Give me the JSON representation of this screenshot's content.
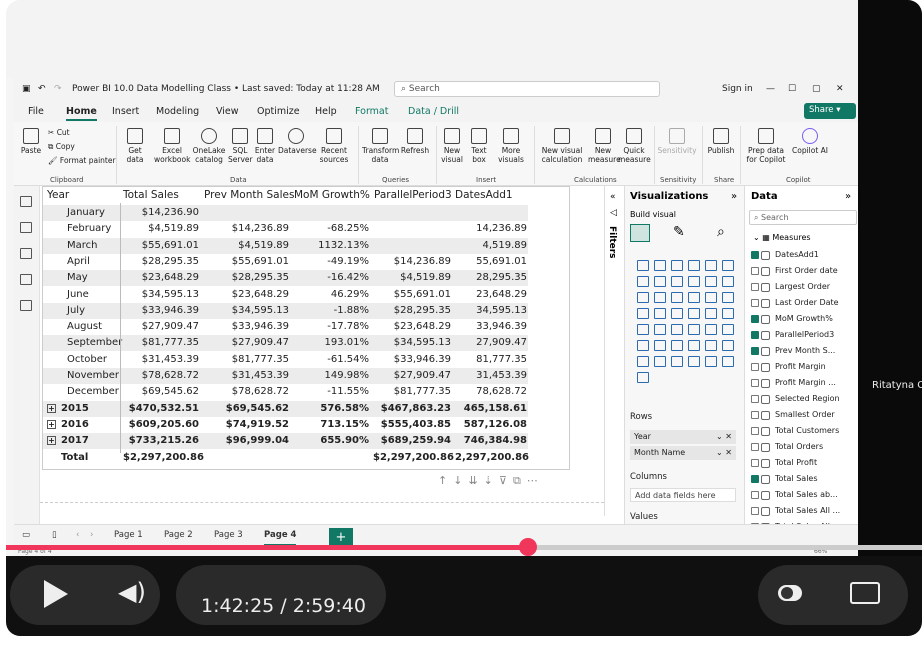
{
  "window": {
    "title": "Power BI 10.0 Data Modelling Class • Last saved: Today at 11:28 AM",
    "search_placeholder": "Search",
    "signin": "Sign in"
  },
  "menu": [
    "File",
    "Home",
    "Insert",
    "Modeling",
    "View",
    "Optimize",
    "Help",
    "Format",
    "Data / Drill"
  ],
  "share_label": "Share",
  "ribbon": {
    "clipboard": {
      "paste": "Paste",
      "cut": "Cut",
      "copy": "Copy",
      "format_painter": "Format painter",
      "group": "Clipboard"
    },
    "data": {
      "items": [
        "Get data",
        "Excel workbook",
        "OneLake catalog",
        "SQL Server",
        "Enter data",
        "Dataverse",
        "Recent sources"
      ],
      "group": "Data"
    },
    "queries": {
      "items": [
        "Transform data",
        "Refresh"
      ],
      "group": "Queries"
    },
    "insert": {
      "items": [
        "New visual",
        "Text box",
        "More visuals"
      ],
      "group": "Insert"
    },
    "calculations": {
      "items": [
        "New visual calculation",
        "New measure",
        "Quick measure"
      ],
      "group": "Calculations"
    },
    "sensitivity": {
      "items": [
        "Sensitivity"
      ],
      "group": "Sensitivity"
    },
    "share": {
      "items": [
        "Publish"
      ],
      "group": "Share"
    },
    "copilot": {
      "items": [
        "Prep data for Copilot",
        "Copilot AI"
      ],
      "group": "Copilot"
    }
  },
  "table": {
    "headers": [
      "Year",
      "Total Sales",
      "Prev Month Sales",
      "MoM Growth%",
      "ParallelPeriod3",
      "DatesAdd1"
    ],
    "rows": [
      {
        "label": "January",
        "v": [
          "$14,236.90",
          "",
          "",
          "",
          ""
        ]
      },
      {
        "label": "February",
        "v": [
          "$4,519.89",
          "$14,236.89",
          "-68.25%",
          "",
          "14,236.89"
        ]
      },
      {
        "label": "March",
        "v": [
          "$55,691.01",
          "$4,519.89",
          "1132.13%",
          "",
          "4,519.89"
        ]
      },
      {
        "label": "April",
        "v": [
          "$28,295.35",
          "$55,691.01",
          "-49.19%",
          "$14,236.89",
          "55,691.01"
        ]
      },
      {
        "label": "May",
        "v": [
          "$23,648.29",
          "$28,295.35",
          "-16.42%",
          "$4,519.89",
          "28,295.35"
        ]
      },
      {
        "label": "June",
        "v": [
          "$34,595.13",
          "$23,648.29",
          "46.29%",
          "$55,691.01",
          "23,648.29"
        ]
      },
      {
        "label": "July",
        "v": [
          "$33,946.39",
          "$34,595.13",
          "-1.88%",
          "$28,295.35",
          "34,595.13"
        ]
      },
      {
        "label": "August",
        "v": [
          "$27,909.47",
          "$33,946.39",
          "-17.78%",
          "$23,648.29",
          "33,946.39"
        ]
      },
      {
        "label": "September",
        "v": [
          "$81,777.35",
          "$27,909.47",
          "193.01%",
          "$34,595.13",
          "27,909.47"
        ]
      },
      {
        "label": "October",
        "v": [
          "$31,453.39",
          "$81,777.35",
          "-61.54%",
          "$33,946.39",
          "81,777.35"
        ]
      },
      {
        "label": "November",
        "v": [
          "$78,628.72",
          "$31,453.39",
          "149.98%",
          "$27,909.47",
          "31,453.39"
        ]
      },
      {
        "label": "December",
        "v": [
          "$69,545.62",
          "$78,628.72",
          "-11.55%",
          "$81,777.35",
          "78,628.72"
        ]
      },
      {
        "label": "2015",
        "v": [
          "$470,532.51",
          "$69,545.62",
          "576.58%",
          "$467,863.23",
          "465,158.61"
        ]
      },
      {
        "label": "2016",
        "v": [
          "$609,205.60",
          "$74,919.52",
          "713.15%",
          "$555,403.85",
          "587,126.08"
        ]
      },
      {
        "label": "2017",
        "v": [
          "$733,215.26",
          "$96,999.04",
          "655.90%",
          "$689,259.94",
          "746,384.98"
        ]
      },
      {
        "label": "Total",
        "v": [
          "$2,297,200.86",
          "",
          "",
          "$2,297,200.86",
          "2,297,200.86"
        ]
      }
    ]
  },
  "filters_label": "Filters",
  "visualizations": {
    "title": "Visualizations",
    "build": "Build visual",
    "rows_label": "Rows",
    "rows": [
      "Year",
      "Month Name"
    ],
    "columns_label": "Columns",
    "columns_placeholder": "Add data fields here",
    "values_label": "Values"
  },
  "data_pane": {
    "title": "Data",
    "search_placeholder": "Search",
    "table": "Measures",
    "fields": [
      {
        "name": "DatesAdd1",
        "checked": true
      },
      {
        "name": "First Order date",
        "checked": false
      },
      {
        "name": "Largest Order",
        "checked": false
      },
      {
        "name": "Last Order Date",
        "checked": false
      },
      {
        "name": "MoM Growth%",
        "checked": true
      },
      {
        "name": "ParallelPeriod3",
        "checked": true
      },
      {
        "name": "Prev Month S...",
        "checked": true
      },
      {
        "name": "Profit Margin",
        "checked": false
      },
      {
        "name": "Profit Margin ...",
        "checked": false
      },
      {
        "name": "Selected Region",
        "checked": false
      },
      {
        "name": "Smallest Order",
        "checked": false
      },
      {
        "name": "Total Customers",
        "checked": false
      },
      {
        "name": "Total Orders",
        "checked": false
      },
      {
        "name": "Total Profit",
        "checked": false
      },
      {
        "name": "Total Sales",
        "checked": true
      },
      {
        "name": "Total Sales ab...",
        "checked": false
      },
      {
        "name": "Total Sales All ...",
        "checked": false
      },
      {
        "name": "Total Sales All...",
        "checked": false
      }
    ]
  },
  "pages": [
    "Page 1",
    "Page 2",
    "Page 3",
    "Page 4"
  ],
  "active_page": "Page 4",
  "add_page": "+",
  "status": {
    "page": "Page 4 of 4",
    "zoom": "66%"
  },
  "video": {
    "time": "1:42:25 / 2:59:40",
    "progress": 0.57,
    "participant": "Ritatyna Ok"
  }
}
